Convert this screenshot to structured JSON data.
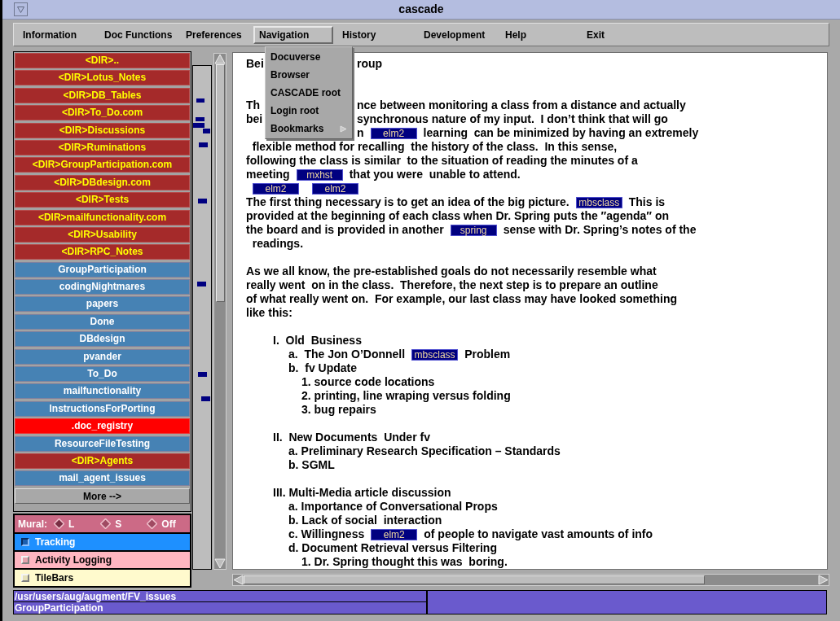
{
  "window": {
    "title": "cascade"
  },
  "menu_bar": [
    {
      "label": "Information",
      "selected": false
    },
    {
      "label": "Doc Functions",
      "selected": false
    },
    {
      "label": "Preferences",
      "selected": false
    },
    {
      "label": "Navigation",
      "selected": true
    },
    {
      "label": "History",
      "selected": false
    },
    {
      "label": "Development",
      "selected": false
    },
    {
      "label": "Help",
      "selected": false
    },
    {
      "label": "Exit",
      "selected": false
    }
  ],
  "dropdown": [
    {
      "label": "Docuverse",
      "kind": "item"
    },
    {
      "label": "Browser",
      "kind": "item"
    },
    {
      "label": "CASCADE root",
      "kind": "item"
    },
    {
      "label": "Login root",
      "kind": "item"
    },
    {
      "label": "Bookmarks",
      "kind": "submenu"
    }
  ],
  "sidebar": {
    "items": [
      {
        "label": "<DIR>..",
        "kind": "dir",
        "color": "#a52a2a"
      },
      {
        "label": "<DIR>Lotus_Notes",
        "kind": "dir",
        "color": "#a52a2a"
      },
      {
        "label": "<DIR>DB_Tables",
        "kind": "dir",
        "color": "#a52a2a"
      },
      {
        "label": "<DIR>To_Do.com",
        "kind": "dir",
        "color": "#a52a2a"
      },
      {
        "label": "<DIR>Discussions",
        "kind": "dir",
        "color": "#a52a2a"
      },
      {
        "label": "<DIR>Ruminations",
        "kind": "dir",
        "color": "#a52a2a"
      },
      {
        "label": "<DIR>GroupParticipation.com",
        "kind": "dir",
        "color": "#a52a2a"
      },
      {
        "label": "<DIR>DBdesign.com",
        "kind": "dir",
        "color": "#a52a2a"
      },
      {
        "label": "<DIR>Tests",
        "kind": "dir",
        "color": "#a52a2a"
      },
      {
        "label": "<DIR>mailfunctionality.com",
        "kind": "dir",
        "color": "#a52a2a"
      },
      {
        "label": "<DIR>Usability",
        "kind": "dir",
        "color": "#a52a2a"
      },
      {
        "label": "<DIR>RPC_Notes",
        "kind": "dir",
        "color": "#a52a2a"
      },
      {
        "label": "GroupParticipation",
        "kind": "doc",
        "color": "#4682b4"
      },
      {
        "label": "codingNightmares",
        "kind": "doc",
        "color": "#4682b4"
      },
      {
        "label": "papers",
        "kind": "doc",
        "color": "#4682b4"
      },
      {
        "label": "Done",
        "kind": "doc",
        "color": "#4682b4"
      },
      {
        "label": "DBdesign",
        "kind": "doc",
        "color": "#4682b4"
      },
      {
        "label": "pvander",
        "kind": "doc",
        "color": "#4682b4"
      },
      {
        "label": "To_Do",
        "kind": "doc",
        "color": "#4682b4"
      },
      {
        "label": "mailfunctionality",
        "kind": "doc",
        "color": "#4682b4"
      },
      {
        "label": "InstructionsForPorting",
        "kind": "doc",
        "color": "#4682b4"
      },
      {
        "label": ".doc_registry",
        "kind": "doc",
        "color": "#ff0000"
      },
      {
        "label": "ResourceFileTesting",
        "kind": "doc",
        "color": "#4682b4"
      },
      {
        "label": "<DIR>Agents",
        "kind": "dir",
        "color": "#a52a2a"
      },
      {
        "label": "mail_agent_issues",
        "kind": "doc",
        "color": "#4682b4"
      }
    ],
    "more_button": "More -->"
  },
  "mural": {
    "label": "Mural:",
    "options": [
      {
        "label": "L",
        "selected": true
      },
      {
        "label": "S",
        "selected": false
      },
      {
        "label": "Off",
        "selected": false
      }
    ]
  },
  "toggles": [
    {
      "label": "Tracking",
      "checked": true,
      "color": "#1e90ff"
    },
    {
      "label": "Activity Logging",
      "checked": false,
      "color": "#ffb6c1"
    },
    {
      "label": "TileBars",
      "checked": false,
      "color": "#fffacd"
    }
  ],
  "document": {
    "lines": [
      {
        "kind": "split",
        "left": "Bei",
        "right": [
          {
            "kind": "text",
            "text": "roup"
          }
        ]
      },
      {
        "kind": "blank"
      },
      {
        "kind": "blank"
      },
      {
        "kind": "split",
        "left": "Th",
        "right": [
          {
            "kind": "text",
            "text": "nce between monitoring a class from a distance and actually"
          }
        ]
      },
      {
        "kind": "split",
        "left": "bei",
        "right": [
          {
            "kind": "text",
            "text": "synchronous nature of my input.  I don’t think that will go"
          }
        ]
      },
      {
        "kind": "split",
        "right": [
          {
            "kind": "text",
            "text": "n"
          },
          {
            "kind": "link",
            "text": "elm2"
          },
          {
            "kind": "text",
            "text": "learning  can be minimized by having an extremely"
          }
        ]
      },
      {
        "kind": "line",
        "segments": [
          {
            "kind": "text",
            "text": "  flexible method for recalling  the history of the class.  In this sense,"
          }
        ]
      },
      {
        "kind": "line",
        "segments": [
          {
            "kind": "text",
            "text": "following the class is similar  to the situation of reading the minutes of a"
          }
        ]
      },
      {
        "kind": "line",
        "segments": [
          {
            "kind": "text",
            "text": "meeting"
          },
          {
            "kind": "link",
            "text": "mxhst"
          },
          {
            "kind": "text",
            "text": "that you were  unable to attend."
          }
        ]
      },
      {
        "kind": "line",
        "segments": [
          {
            "kind": "link",
            "text": "elm2"
          },
          {
            "kind": "link",
            "text": "elm2"
          }
        ]
      },
      {
        "kind": "line",
        "segments": [
          {
            "kind": "text",
            "text": "The first thing necessary is to get an idea of the big picture."
          },
          {
            "kind": "link",
            "text": "mbsclass"
          },
          {
            "kind": "text",
            "text": "This is"
          }
        ]
      },
      {
        "kind": "line",
        "segments": [
          {
            "kind": "text",
            "text": "provided at the beginning of each class when Dr. Spring puts the ″agenda″ on"
          }
        ]
      },
      {
        "kind": "line",
        "segments": [
          {
            "kind": "text",
            "text": "the board and is provided in another"
          },
          {
            "kind": "link",
            "text": "spring"
          },
          {
            "kind": "text",
            "text": "sense with Dr. Spring’s notes of the"
          }
        ]
      },
      {
        "kind": "line",
        "segments": [
          {
            "kind": "text",
            "text": "  readings."
          }
        ]
      },
      {
        "kind": "blank"
      },
      {
        "kind": "line",
        "segments": [
          {
            "kind": "text",
            "text": "As we all know, the pre-established goals do not necessarily resemble what"
          }
        ]
      },
      {
        "kind": "line",
        "segments": [
          {
            "kind": "text",
            "text": "really went  on in the class.  Therefore, the next step is to prepare an outline"
          }
        ]
      },
      {
        "kind": "line",
        "segments": [
          {
            "kind": "text",
            "text": "of what really went on.  For example, our last class may have looked something"
          }
        ]
      },
      {
        "kind": "line",
        "segments": [
          {
            "kind": "text",
            "text": "like this:"
          }
        ]
      },
      {
        "kind": "blank"
      }
    ],
    "outline": [
      {
        "segments": [
          {
            "kind": "text",
            "text": "I.  Old  Business"
          }
        ],
        "children": [
          {
            "segments": [
              {
                "kind": "text",
                "text": "a.  The Jon O’Donnell"
              },
              {
                "kind": "link",
                "text": "mbsclass"
              },
              {
                "kind": "text",
                "text": "Problem"
              }
            ]
          },
          {
            "segments": [
              {
                "kind": "text",
                "text": "b.  fv Update"
              }
            ],
            "children": [
              {
                "segments": [
                  {
                    "kind": "text",
                    "text": "1. source code locations"
                  }
                ]
              },
              {
                "segments": [
                  {
                    "kind": "text",
                    "text": "2. printing, line wraping versus folding"
                  }
                ]
              },
              {
                "segments": [
                  {
                    "kind": "text",
                    "text": "3. bug repairs"
                  }
                ]
              }
            ]
          }
        ]
      },
      {
        "segments": [
          {
            "kind": "text",
            "text": "II.  New Documents  Under fv"
          }
        ],
        "children": [
          {
            "segments": [
              {
                "kind": "text",
                "text": "a. Preliminary Research Specification – Standards"
              }
            ]
          },
          {
            "segments": [
              {
                "kind": "text",
                "text": "b. SGML"
              }
            ]
          }
        ]
      },
      {
        "segments": [
          {
            "kind": "text",
            "text": "III. Multi-Media article discussion"
          }
        ],
        "children": [
          {
            "segments": [
              {
                "kind": "text",
                "text": "a. Importance of Conversational Props"
              }
            ]
          },
          {
            "segments": [
              {
                "kind": "text",
                "text": "b. Lack of social  interaction"
              }
            ]
          },
          {
            "segments": [
              {
                "kind": "text",
                "text": "c. Willingness"
              },
              {
                "kind": "link",
                "text": "elm2"
              },
              {
                "kind": "text",
                "text": "of people to navigate vast amounts of info"
              }
            ]
          },
          {
            "segments": [
              {
                "kind": "text",
                "text": "d. Document Retrieval versus Filtering"
              }
            ],
            "children": [
              {
                "segments": [
                  {
                    "kind": "text",
                    "text": "1. Dr. Spring thought this was  boring."
                  }
                ]
              }
            ]
          }
        ]
      }
    ]
  },
  "status_bar": {
    "path": "/usr/users/aug/augment/FV_issues",
    "document": "GroupParticipation"
  }
}
